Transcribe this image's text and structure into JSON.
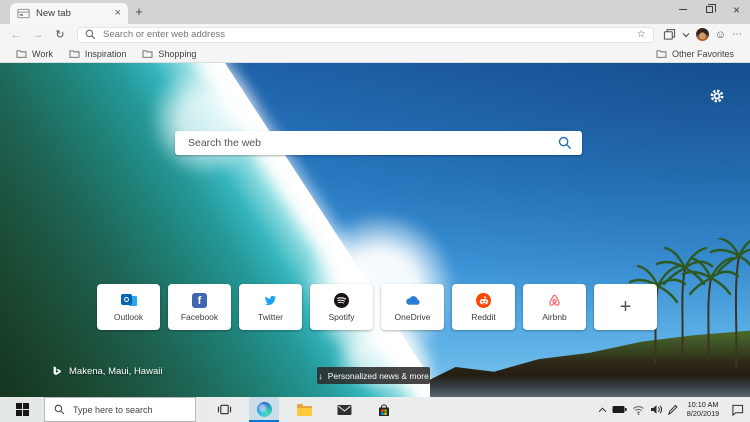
{
  "browser": {
    "tab": {
      "title": "New tab",
      "close_glyph": "×"
    },
    "newtab_button_glyph": "+",
    "window_controls": {
      "close_glyph": "×"
    },
    "toolbar": {
      "back_glyph": "←",
      "forward_glyph": "→",
      "refresh_glyph": "↻",
      "address_placeholder": "Search or enter web address",
      "star_glyph": "☆",
      "smiley_glyph": "☺",
      "more_glyph": "⋯"
    },
    "favorites_bar": {
      "items": [
        {
          "label": "Work"
        },
        {
          "label": "Inspiration"
        },
        {
          "label": "Shopping"
        }
      ],
      "other": {
        "label": "Other Favorites"
      }
    }
  },
  "newtab": {
    "search_placeholder": "Search the web",
    "tiles": [
      {
        "label": "Outlook",
        "color": "#0364b8"
      },
      {
        "label": "Facebook",
        "color": "#4267b2"
      },
      {
        "label": "Twitter",
        "color": "#1da1f2"
      },
      {
        "label": "Spotify",
        "color": "#191414"
      },
      {
        "label": "OneDrive",
        "color": "#2a7cd4"
      },
      {
        "label": "Reddit",
        "color": "#ff4500"
      },
      {
        "label": "Airbnb",
        "color": "#ff5a5f"
      }
    ],
    "add_tile_glyph": "+",
    "attribution": "Makena, Maui, Hawaii",
    "news_button": {
      "arrow_glyph": "↓",
      "label": "Personalized news & more"
    }
  },
  "taskbar": {
    "search_placeholder": "Type here to search",
    "clock": {
      "time": "10:10 AM",
      "date": "8/20/2019"
    }
  },
  "colors": {
    "accent_blue": "#0078d7",
    "search_magnifier_blue": "#2272b9",
    "news_pill_bg": "#2b2b2b",
    "taskbar_bg": "#ebedec",
    "chrome_bg": "#f5f5f5",
    "tabstrip_bg": "#d2d3d5"
  }
}
